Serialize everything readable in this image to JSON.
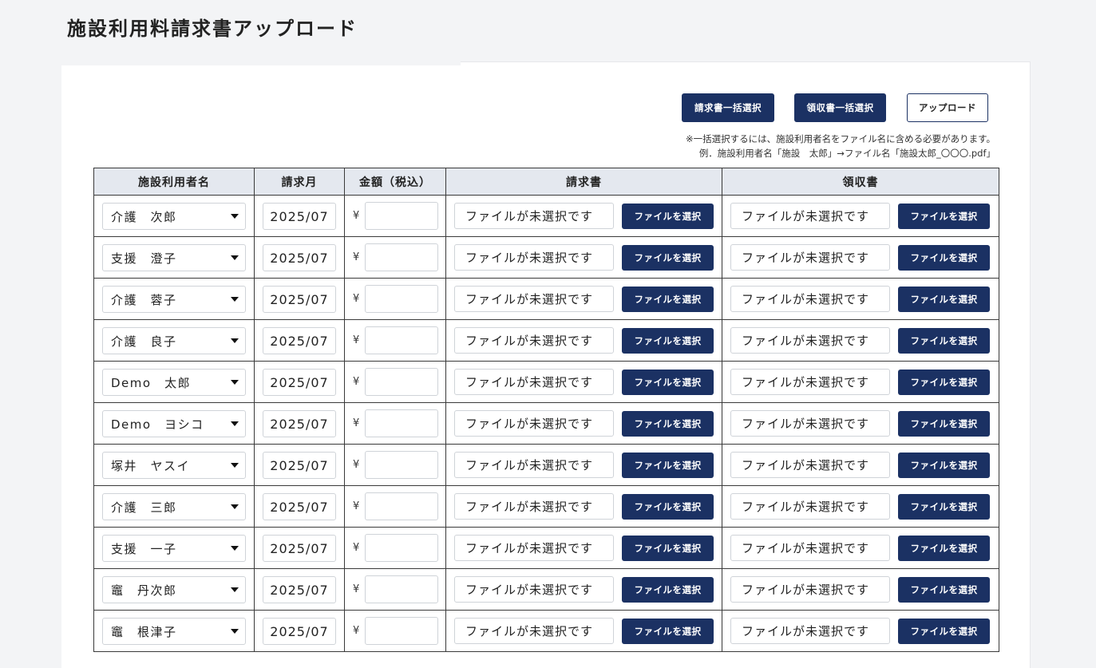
{
  "page": {
    "title": "施設利用料請求書アップロード"
  },
  "toolbar": {
    "bulk_invoice_label": "請求書一括選択",
    "bulk_receipt_label": "領収書一括選択",
    "upload_label": "アップロード",
    "note_line1": "※一括選択するには、施設利用者名をファイル名に含める必要があります。",
    "note_line2": "例．施設利用者名「施設　太郎」→ファイル名「施設太郎_〇〇〇.pdf」"
  },
  "table": {
    "headers": [
      "施設利用者名",
      "請求月",
      "金額（税込）",
      "請求書",
      "領収書"
    ],
    "currency_symbol": "¥",
    "no_file_text": "ファイルが未選択です",
    "choose_file_label": "ファイルを選択",
    "rows": [
      {
        "name": "介護　次郎",
        "month": "2025/07",
        "amount": ""
      },
      {
        "name": "支援　澄子",
        "month": "2025/07",
        "amount": ""
      },
      {
        "name": "介護　蓉子",
        "month": "2025/07",
        "amount": ""
      },
      {
        "name": "介護　良子",
        "month": "2025/07",
        "amount": ""
      },
      {
        "name": "Demo　太郎",
        "month": "2025/07",
        "amount": ""
      },
      {
        "name": "Demo　ヨシコ",
        "month": "2025/07",
        "amount": ""
      },
      {
        "name": "塚井　ヤスイ",
        "month": "2025/07",
        "amount": ""
      },
      {
        "name": "介護　三郎",
        "month": "2025/07",
        "amount": ""
      },
      {
        "name": "支援　一子",
        "month": "2025/07",
        "amount": ""
      },
      {
        "name": "竈　丹次郎",
        "month": "2025/07",
        "amount": ""
      },
      {
        "name": "竈　根津子",
        "month": "2025/07",
        "amount": ""
      }
    ]
  },
  "colors": {
    "primary": "#1b3163",
    "header_bg": "#e4e8ef",
    "page_bg": "#f3f4f6"
  }
}
